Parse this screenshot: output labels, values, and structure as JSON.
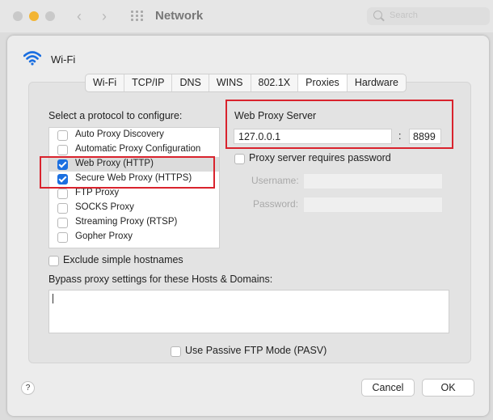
{
  "window": {
    "title": "Network",
    "search_placeholder": "Search"
  },
  "interface": {
    "name": "Wi-Fi",
    "icon": "wifi-icon"
  },
  "tabs": [
    {
      "label": "Wi-Fi"
    },
    {
      "label": "TCP/IP"
    },
    {
      "label": "DNS"
    },
    {
      "label": "WINS"
    },
    {
      "label": "802.1X"
    },
    {
      "label": "Proxies",
      "active": true
    },
    {
      "label": "Hardware"
    }
  ],
  "protocols": {
    "title": "Select a protocol to configure:",
    "items": [
      {
        "label": "Auto Proxy Discovery",
        "checked": false
      },
      {
        "label": "Automatic Proxy Configuration",
        "checked": false
      },
      {
        "label": "Web Proxy (HTTP)",
        "checked": true
      },
      {
        "label": "Secure Web Proxy (HTTPS)",
        "checked": true
      },
      {
        "label": "FTP Proxy",
        "checked": false
      },
      {
        "label": "SOCKS Proxy",
        "checked": false
      },
      {
        "label": "Streaming Proxy (RTSP)",
        "checked": false
      },
      {
        "label": "Gopher Proxy",
        "checked": false
      }
    ]
  },
  "server": {
    "title": "Web Proxy Server",
    "host": "127.0.0.1",
    "separator": ":",
    "port": "8899",
    "requires_password_label": "Proxy server requires password",
    "username_label": "Username:",
    "password_label": "Password:"
  },
  "exclude_label": "Exclude simple hostnames",
  "bypass_label": "Bypass proxy settings for these Hosts & Domains:",
  "passive_ftp_label": "Use Passive FTP Mode (PASV)",
  "footer": {
    "help": "?",
    "cancel": "Cancel",
    "ok": "OK"
  },
  "colors": {
    "accent": "#1b6fe0",
    "highlight": "#d9232d"
  }
}
